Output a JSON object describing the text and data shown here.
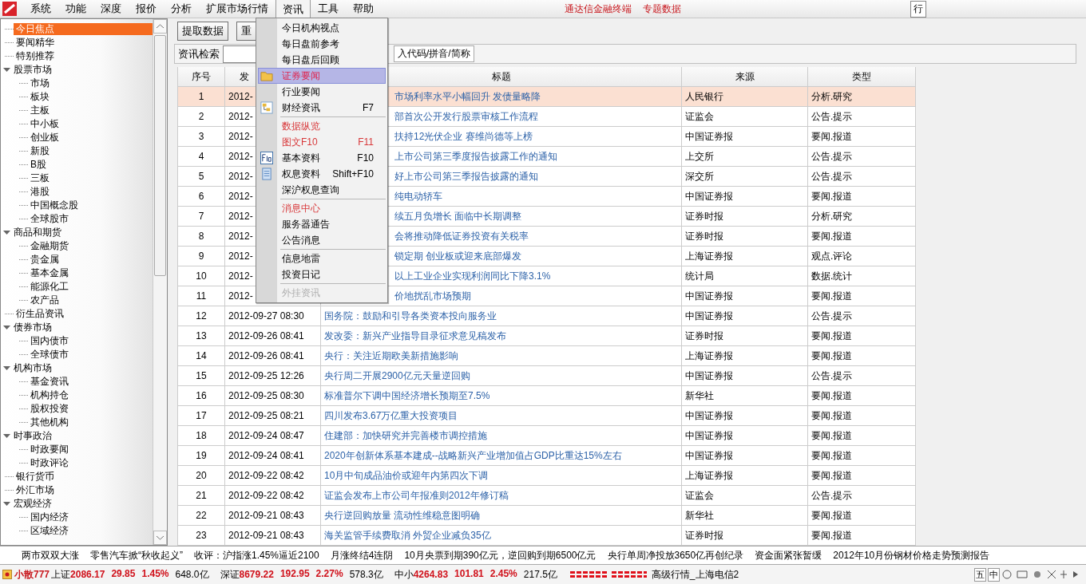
{
  "menubar": {
    "items": [
      {
        "label": "系统",
        "selected": false
      },
      {
        "label": "功能",
        "selected": false
      },
      {
        "label": "深度",
        "selected": false
      },
      {
        "label": "报价",
        "selected": false
      },
      {
        "label": "分析",
        "selected": false
      },
      {
        "label": "扩展市场行情",
        "selected": false
      },
      {
        "label": "资讯",
        "selected": true
      },
      {
        "label": "工具",
        "selected": false
      },
      {
        "label": "帮助",
        "selected": false
      }
    ],
    "links": [
      "通达信金融终端",
      "专题数据"
    ],
    "right_button": "行"
  },
  "sidebar": {
    "items": [
      {
        "label": "今日焦点",
        "selected": true
      },
      {
        "label": "要闻精华",
        "selected": false
      },
      {
        "label": "特别推荐",
        "selected": false
      },
      {
        "label": "股票市场",
        "selected": false,
        "expanded": true,
        "children": [
          {
            "label": "市场",
            "selected": false
          },
          {
            "label": "板块",
            "selected": false
          },
          {
            "label": "主板",
            "selected": false
          },
          {
            "label": "中小板",
            "selected": false
          },
          {
            "label": "创业板",
            "selected": false
          },
          {
            "label": "新股",
            "selected": false
          },
          {
            "label": "B股",
            "selected": false
          },
          {
            "label": "三板",
            "selected": false
          },
          {
            "label": "港股",
            "selected": false
          },
          {
            "label": "中国概念股",
            "selected": false
          },
          {
            "label": "全球股市",
            "selected": false
          }
        ]
      },
      {
        "label": "商品和期货",
        "selected": false,
        "expanded": true,
        "children": [
          {
            "label": "金融期货",
            "selected": false
          },
          {
            "label": "贵金属",
            "selected": false
          },
          {
            "label": "基本金属",
            "selected": false
          },
          {
            "label": "能源化工",
            "selected": false
          },
          {
            "label": "农产品",
            "selected": false
          }
        ]
      },
      {
        "label": "衍生品资讯",
        "selected": false
      },
      {
        "label": "债券市场",
        "selected": false,
        "expanded": true,
        "children": [
          {
            "label": "国内债市",
            "selected": false
          },
          {
            "label": "全球债市",
            "selected": false
          }
        ]
      },
      {
        "label": "机构市场",
        "selected": false,
        "expanded": true,
        "children": [
          {
            "label": "基金资讯",
            "selected": false
          },
          {
            "label": "机构持仓",
            "selected": false
          },
          {
            "label": "股权投资",
            "selected": false
          },
          {
            "label": "其他机构",
            "selected": false
          }
        ]
      },
      {
        "label": "时事政治",
        "selected": false,
        "expanded": true,
        "children": [
          {
            "label": "时政要闻",
            "selected": false
          },
          {
            "label": "时政评论",
            "selected": false
          }
        ]
      },
      {
        "label": "银行货币",
        "selected": false
      },
      {
        "label": "外汇市场",
        "selected": false
      },
      {
        "label": "宏观经济",
        "selected": false,
        "expanded": true,
        "children": [
          {
            "label": "国内经济",
            "selected": false
          },
          {
            "label": "区域经济",
            "selected": false
          }
        ]
      }
    ]
  },
  "toolbar": {
    "buttons": [
      "提取数据",
      "重"
    ]
  },
  "search": {
    "label": "资讯检索",
    "hint_box": "入代码/拼音/简称"
  },
  "table": {
    "columns": [
      "序号",
      "发",
      "标题",
      "来源",
      "类型"
    ],
    "rows": [
      {
        "no": "1",
        "time": "2012-",
        "title": "市场利率水平小幅回升 发债量略降",
        "source": "人民银行",
        "type": "分析.研究",
        "selected": true,
        "covered": true
      },
      {
        "no": "2",
        "time": "2012-",
        "title": "部首次公开发行股票审核工作流程",
        "source": "证监会",
        "type": "公告.提示",
        "selected": false,
        "covered": true
      },
      {
        "no": "3",
        "time": "2012-",
        "title": "扶持12光伏企业 赛维尚德等上榜",
        "source": "中国证券报",
        "type": "要闻.报道",
        "selected": false,
        "covered": true
      },
      {
        "no": "4",
        "time": "2012-",
        "title": "上市公司第三季度报告披露工作的通知",
        "source": "上交所",
        "type": "公告.提示",
        "selected": false,
        "covered": true
      },
      {
        "no": "5",
        "time": "2012-",
        "title": "好上市公司第三季报告披露的通知",
        "source": "深交所",
        "type": "公告.提示",
        "selected": false,
        "covered": true
      },
      {
        "no": "6",
        "time": "2012-",
        "title": "纯电动轿车",
        "source": "中国证券报",
        "type": "要闻.报道",
        "selected": false,
        "covered": true
      },
      {
        "no": "7",
        "time": "2012-",
        "title": "续五月负增长 面临中长期调整",
        "source": "证券时报",
        "type": "分析.研究",
        "selected": false,
        "covered": true
      },
      {
        "no": "8",
        "time": "2012-",
        "title": "会将推动降低证券投资有关税率",
        "source": "证券时报",
        "type": "要闻.报道",
        "selected": false,
        "covered": true
      },
      {
        "no": "9",
        "time": "2012-",
        "title": "锁定期 创业板或迎来底部爆发",
        "source": "上海证券报",
        "type": "观点.评论",
        "selected": false,
        "covered": true
      },
      {
        "no": "10",
        "time": "2012-",
        "title": "以上工业企业实现利润同比下降3.1%",
        "source": "统计局",
        "type": "数据.统计",
        "selected": false,
        "covered": true
      },
      {
        "no": "11",
        "time": "2012-",
        "title": "价地扰乱市场预期",
        "source": "中国证券报",
        "type": "要闻.报道",
        "selected": false,
        "covered": true
      },
      {
        "no": "12",
        "time": "2012-09-27 08:30",
        "title": "国务院：鼓励和引导各类资本投向服务业",
        "source": "中国证券报",
        "type": "公告.提示",
        "selected": false,
        "covered": false
      },
      {
        "no": "13",
        "time": "2012-09-26 08:41",
        "title": "发改委：新兴产业指导目录征求意见稿发布",
        "source": "证券时报",
        "type": "要闻.报道",
        "selected": false,
        "covered": false
      },
      {
        "no": "14",
        "time": "2012-09-26 08:41",
        "title": "央行：关注近期欧美新措施影响",
        "source": "上海证券报",
        "type": "要闻.报道",
        "selected": false,
        "covered": false
      },
      {
        "no": "15",
        "time": "2012-09-25 12:26",
        "title": "央行周二开展2900亿元天量逆回购",
        "source": "中国证券报",
        "type": "公告.提示",
        "selected": false,
        "covered": false
      },
      {
        "no": "16",
        "time": "2012-09-25 08:30",
        "title": "标准普尔下调中国经济增长预期至7.5%",
        "source": "新华社",
        "type": "要闻.报道",
        "selected": false,
        "covered": false
      },
      {
        "no": "17",
        "time": "2012-09-25 08:21",
        "title": "四川发布3.67万亿重大投资项目",
        "source": "中国证券报",
        "type": "要闻.报道",
        "selected": false,
        "covered": false
      },
      {
        "no": "18",
        "time": "2012-09-24 08:47",
        "title": "住建部：加快研究并完善楼市调控措施",
        "source": "中国证券报",
        "type": "要闻.报道",
        "selected": false,
        "covered": false
      },
      {
        "no": "19",
        "time": "2012-09-24 08:41",
        "title": "2020年创新体系基本建成--战略新兴产业增加值占GDP比重达15%左右",
        "source": "中国证券报",
        "type": "要闻.报道",
        "selected": false,
        "covered": false
      },
      {
        "no": "20",
        "time": "2012-09-22 08:42",
        "title": "10月中旬成品油价或迎年内第四次下调",
        "source": "上海证券报",
        "type": "要闻.报道",
        "selected": false,
        "covered": false
      },
      {
        "no": "21",
        "time": "2012-09-22 08:42",
        "title": "证监会发布上市公司年报准则2012年修订稿",
        "source": "证监会",
        "type": "公告.提示",
        "selected": false,
        "covered": false
      },
      {
        "no": "22",
        "time": "2012-09-21 08:43",
        "title": "央行逆回购放量 流动性维稳意图明确",
        "source": "新华社",
        "type": "要闻.报道",
        "selected": false,
        "covered": false
      },
      {
        "no": "23",
        "time": "2012-09-21 08:43",
        "title": "海关监管手续费取消 外贸企业减负35亿",
        "source": "证券时报",
        "type": "要闻.报道",
        "selected": false,
        "covered": false
      }
    ]
  },
  "dropdown": {
    "items": [
      {
        "kind": "item",
        "label": "今日机构视点",
        "selected": false
      },
      {
        "kind": "item",
        "label": "每日盘前参考",
        "selected": false
      },
      {
        "kind": "item",
        "label": "每日盘后回顾",
        "selected": false
      },
      {
        "kind": "item",
        "label": "证券要闻",
        "selected": true
      },
      {
        "kind": "item",
        "label": "行业要闻",
        "selected": false
      },
      {
        "kind": "item",
        "label": "财经资讯",
        "shortcut": "F7",
        "selected": false
      },
      {
        "kind": "separator"
      },
      {
        "kind": "item",
        "label": "数据纵览",
        "selected": false,
        "emphasized": true
      },
      {
        "kind": "item",
        "label": "图文F10",
        "shortcut": "F11",
        "selected": false,
        "emphasized": true
      },
      {
        "kind": "item",
        "label": "基本资料",
        "shortcut": "F10",
        "selected": false
      },
      {
        "kind": "item",
        "label": "权息资料",
        "shortcut": "Shift+F10",
        "selected": false
      },
      {
        "kind": "item",
        "label": "深沪权息查询",
        "selected": false
      },
      {
        "kind": "separator"
      },
      {
        "kind": "item",
        "label": "消息中心",
        "selected": false,
        "emphasized": true
      },
      {
        "kind": "item",
        "label": "服务器通告",
        "selected": false
      },
      {
        "kind": "item",
        "label": "公告消息",
        "selected": false
      },
      {
        "kind": "separator"
      },
      {
        "kind": "item",
        "label": "信息地雷",
        "selected": false
      },
      {
        "kind": "item",
        "label": "投资日记",
        "selected": false
      },
      {
        "kind": "separator"
      },
      {
        "kind": "item",
        "label": "外挂资讯",
        "selected": false,
        "disabled": true
      }
    ]
  },
  "ticker": [
    "两市双双大涨",
    "零售汽车掀“秋收起义”",
    "收评：沪指涨1.45%逼近2100",
    "月涨终结4连阴",
    "10月央票到期390亿元，逆回购到期6500亿元",
    "央行单周净投放3650亿再创纪录",
    "资金面紧张暂缓",
    "2012年10月份钢材价格走势预测报告"
  ],
  "status_bar": {
    "user": "小散777",
    "indices": [
      {
        "name": "上证",
        "value": "2086.17",
        "change": "29.85",
        "percent": "1.45%",
        "amount": "648.0亿"
      },
      {
        "name": "深证",
        "value": "8679.22",
        "change": "192.95",
        "percent": "2.27%",
        "amount": "578.3亿"
      },
      {
        "name": "中小",
        "value": "4264.83",
        "change": "101.81",
        "percent": "2.45%",
        "amount": "217.5亿"
      }
    ],
    "server": "高级行情_上海电信2",
    "tray": [
      "五",
      "中"
    ]
  }
}
